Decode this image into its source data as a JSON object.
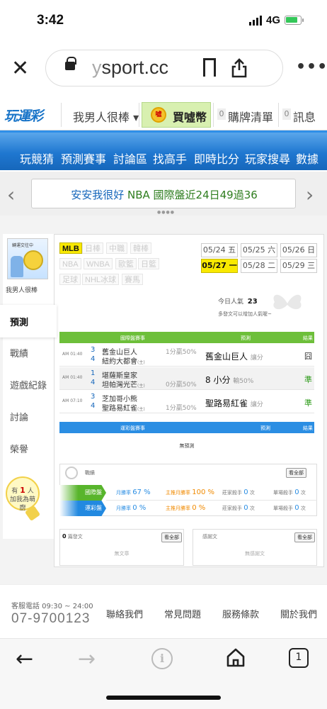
{
  "status": {
    "time": "3:42",
    "network": "4G"
  },
  "browser": {
    "url_prefix": "y",
    "url": "sport.cc",
    "more": "•••"
  },
  "header": {
    "logo": "玩運彩",
    "user_menu": "我男人很棒",
    "coin_label": "買噓幣",
    "coin_icon_text": "噓",
    "bought_count": "0",
    "bought_label": "購牌清單",
    "msg_count": "0",
    "msg_label": "訊息"
  },
  "nav": {
    "items": [
      "玩競猜",
      "預測賽事",
      "討論區",
      "找高手",
      "即時比分",
      "玩家搜尋",
      "數據"
    ]
  },
  "ticker": {
    "pre": "安安我很好",
    "league": "NBA",
    "post": "國際盤近24日49過36"
  },
  "sidebar": {
    "avatar_caption": "轉運交往中",
    "username": "我男人很棒",
    "items": [
      "預測",
      "戰績",
      "遊戲紀錄",
      "討論",
      "榮譽"
    ],
    "bulb_pre": "有",
    "bulb_count": "1",
    "bulb_mid": "人",
    "bulb_post": "加我為萌廚"
  },
  "leagues": {
    "row1": [
      "MLB",
      "日棒",
      "中職",
      "韓棒"
    ],
    "row2": [
      "NBA",
      "WNBA",
      "歐籃",
      "日籃"
    ],
    "row3": [
      "足球",
      "NHL冰球",
      "賽馬"
    ]
  },
  "dates": {
    "row1": [
      "05/24 五",
      "05/25 六",
      "05/26 日"
    ],
    "row2": [
      "05/27 一",
      "05/28 二",
      "05/29 三"
    ]
  },
  "popularity": {
    "label": "今日人氣",
    "value": "23",
    "sub": "多發文可以增加人氣喔~"
  },
  "intl_table": {
    "headers": [
      "國際盤賽事",
      "預測",
      "結果"
    ],
    "rows": [
      {
        "time": "AM 01:40",
        "n1": "3",
        "t1": "舊金山巨人",
        "n2": "4",
        "t2": "紐約大都會",
        "t2_suffix": "(主)",
        "odds": "1分贏50%",
        "pick": "舊金山巨人",
        "pick_note": "讓分",
        "result": "囧",
        "result_color": "#333"
      },
      {
        "time": "AM 01:40",
        "n1": "1",
        "t1": "堪薩斯皇家",
        "n2": "4",
        "t2": "坦帕灣光芒",
        "t2_suffix": "(主)",
        "odds": "0分贏50%",
        "pick": "8 小分",
        "pick_note": "輸50%",
        "result": "準",
        "result_color": "#2e9b1a"
      },
      {
        "time": "AM 07:10",
        "n1": "3",
        "t1": "芝加哥小熊",
        "n2": "4",
        "t2": "聖路易紅雀",
        "t2_suffix": "(主)",
        "odds": "1分贏50%",
        "pick": "聖路易紅雀",
        "pick_note": "讓分",
        "result": "準",
        "result_color": "#2e9b1a"
      }
    ]
  },
  "local_table": {
    "headers": [
      "運彩盤賽事",
      "預測",
      "結果"
    ],
    "empty": "無預測"
  },
  "stats": {
    "title": "戰績",
    "view_all": "看全部",
    "rows": [
      {
        "tab": "國際盤",
        "month_label": "月勝率",
        "month_val": "67 %",
        "main_label": "主推月勝率",
        "main_val": "100 %",
        "away_label": "莊家殺手",
        "away_val": "0",
        "away_unit": "次",
        "single_label": "單場殺手",
        "single_val": "0",
        "single_unit": "次"
      },
      {
        "tab": "運彩盤",
        "month_label": "月勝率",
        "month_val": "0 %",
        "main_label": "主推月勝率",
        "main_val": "0 %",
        "away_label": "莊家殺手",
        "away_val": "0",
        "away_unit": "次",
        "single_label": "單場殺手",
        "single_val": "0",
        "single_unit": "次"
      }
    ]
  },
  "articles": {
    "left_count": "0",
    "left_title": "篇發文",
    "left_btn": "看全部",
    "left_empty": "無文章",
    "right_title": "感謝文",
    "right_btn": "看全部",
    "right_empty": "無感謝文"
  },
  "footer": {
    "cs_label": "客服電話 09:30 ~ 24:00",
    "cs_phone": "07-9700123",
    "links": [
      "聯絡我們",
      "常見問題",
      "服務條款",
      "關於我們"
    ]
  },
  "toolbar": {
    "tabs_count": "1"
  }
}
